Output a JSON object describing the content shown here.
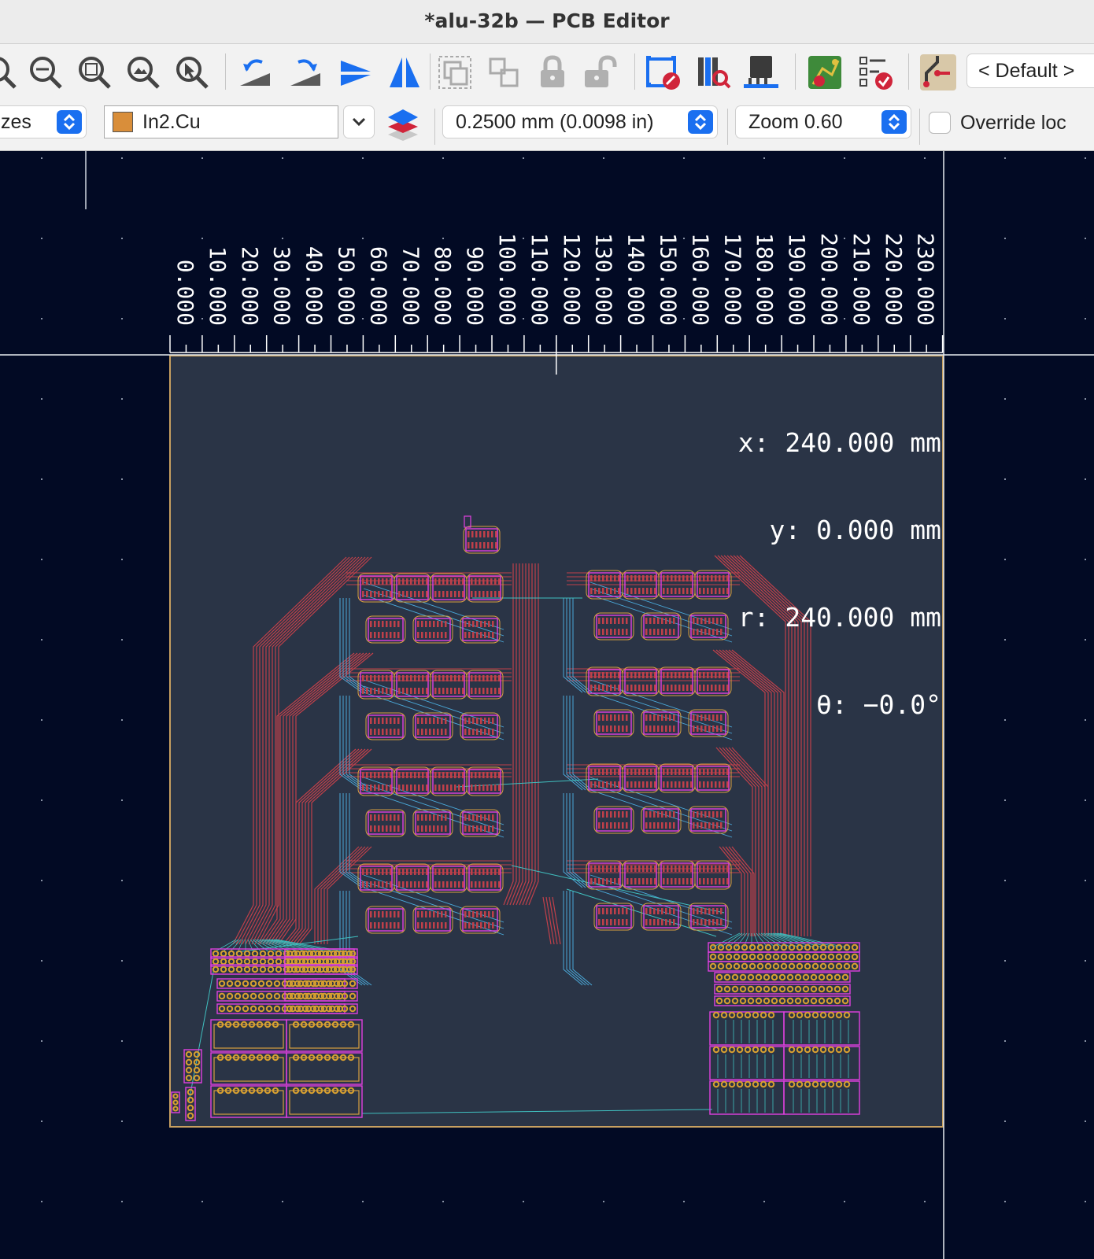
{
  "window": {
    "title": "*alu-32b — PCB Editor"
  },
  "toolbar": {
    "netclass_preset": "< Default >",
    "size_combo_partial": "zes",
    "layer": {
      "name": "In2.Cu",
      "color": "#d98e3a"
    },
    "track_width": "0.2500 mm (0.0098 in)",
    "zoom": "Zoom 0.60",
    "override_label": "Override loc",
    "override_checked": false,
    "icons": [
      "zoom-in-partial-icon",
      "zoom-out-icon",
      "zoom-fit-icon",
      "zoom-objects-icon",
      "zoom-selection-icon",
      "rotate-ccw-icon",
      "rotate-cw-icon",
      "mirror-vertical-icon",
      "mirror-horizontal-icon",
      "group-icon",
      "ungroup-icon",
      "lock-icon",
      "unlock-icon",
      "drc-icon",
      "footprint-library-icon",
      "footprint-editor-icon",
      "pcb-update-icon",
      "board-check-icon",
      "interactive-router-icon"
    ]
  },
  "ruler": {
    "unit": "mm",
    "labels": [
      "0.000",
      "10.000",
      "20.000",
      "30.000",
      "40.000",
      "50.000",
      "60.000",
      "70.000",
      "80.000",
      "90.000",
      "100.000",
      "110.000",
      "120.000",
      "130.000",
      "140.000",
      "150.000",
      "160.000",
      "170.000",
      "180.000",
      "190.000",
      "200.000",
      "210.000",
      "220.000",
      "230.000"
    ]
  },
  "coordinates": {
    "x": "x: 240.000 mm",
    "y": "y: 0.000 mm",
    "r": "r: 240.000 mm",
    "theta": "θ: −0.0°"
  },
  "colors": {
    "background": "#020a24",
    "board": "#2a3446",
    "board_edge": "#c8a060",
    "copper_inner": "#c0404a",
    "copper_b": "#4aa8d8",
    "courtyard": "#e040e0",
    "silkscreen": "#d8a040",
    "pad": "#d8a030",
    "ratsnest": "#40c0c0",
    "accent": "#1a6ff0"
  }
}
